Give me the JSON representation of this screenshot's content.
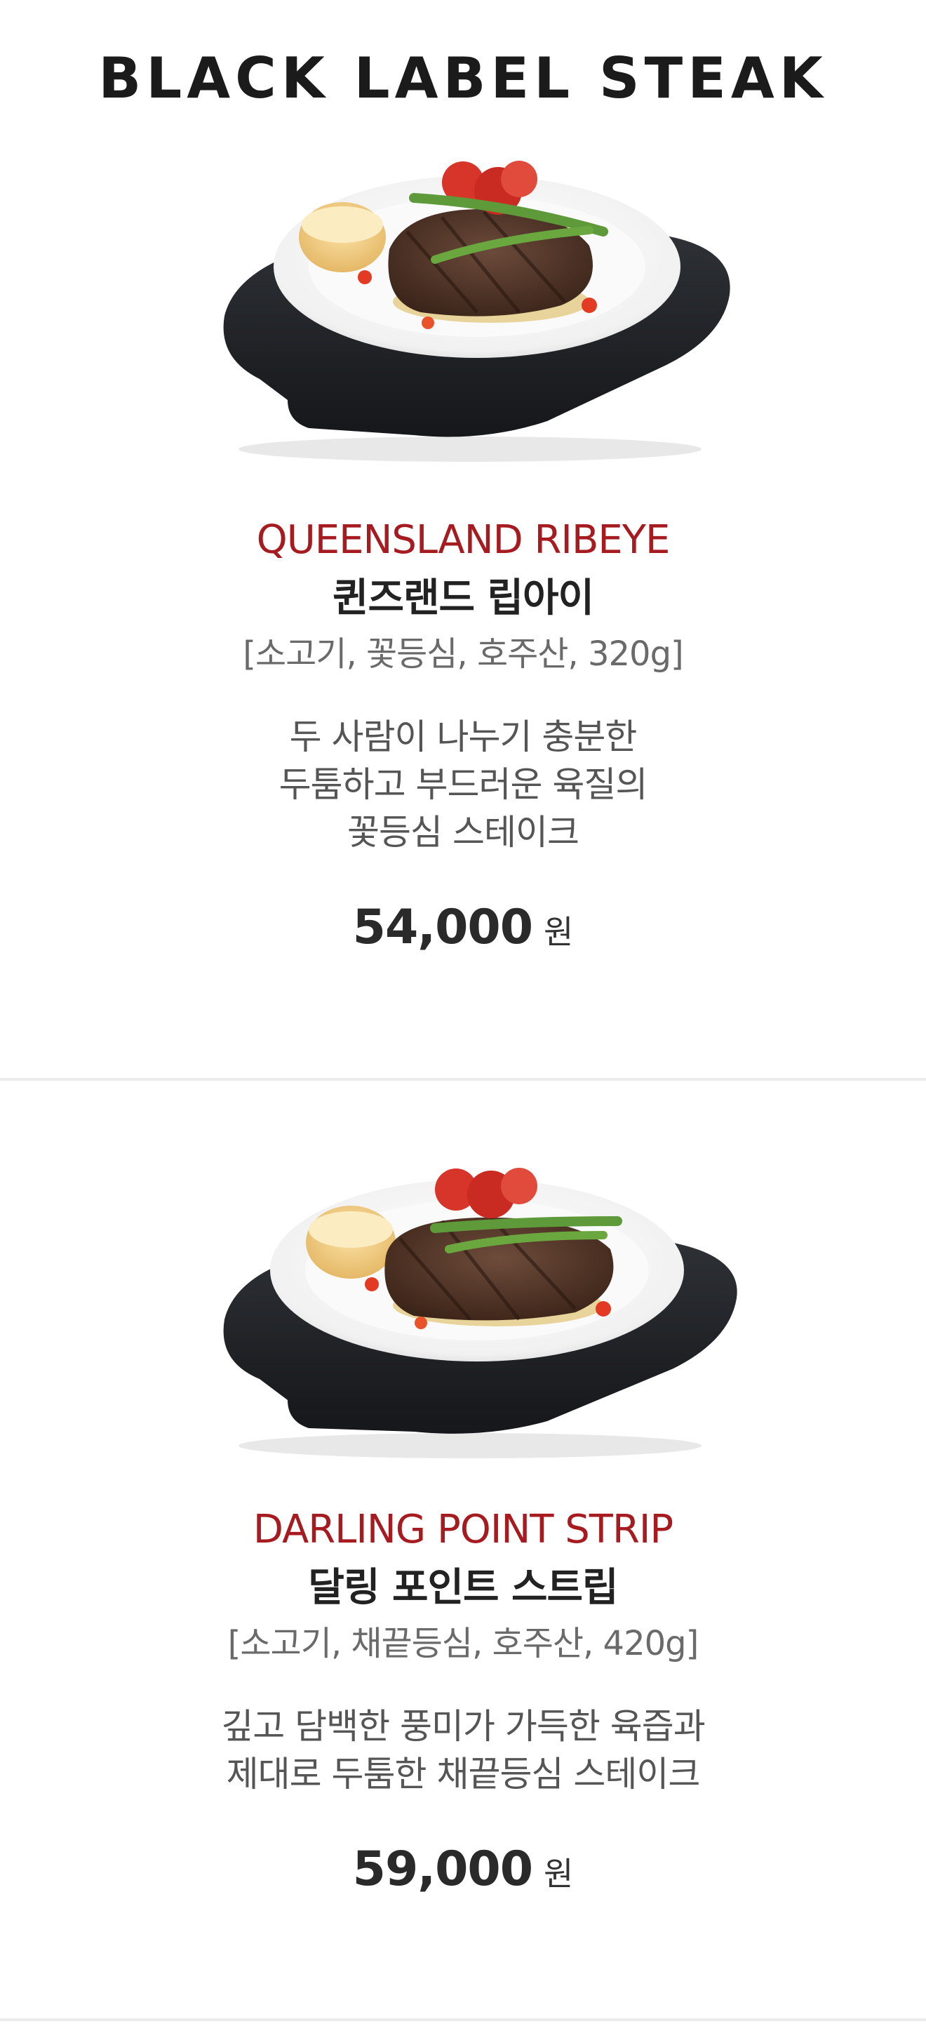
{
  "header": {
    "title": "BLACK LABEL STEAK"
  },
  "menu_items": [
    {
      "name_en": "QUEENSLAND RIBEYE",
      "name_ko": "퀸즈랜드 립아이",
      "spec": "[소고기, 꽃등심, 호주산, 320g]",
      "description_lines": [
        "두 사람이 나누기 충분한",
        "두툼하고 부드러운 육질의",
        "꽃등심 스테이크"
      ],
      "price": "54,000",
      "price_unit": "원"
    },
    {
      "name_en": "DARLING POINT STRIP",
      "name_ko": "달링 포인트 스트립",
      "spec": "[소고기, 채끝등심, 호주산, 420g]",
      "description_lines": [
        "깊고 담백한 풍미가 가득한 육즙과",
        "제대로 두툼한 채끝등심 스테이크"
      ],
      "price": "59,000",
      "price_unit": "원"
    }
  ],
  "colors": {
    "accent_red": "#a61b1f",
    "title_black": "#1b1b1b",
    "divider": "#ececec"
  }
}
